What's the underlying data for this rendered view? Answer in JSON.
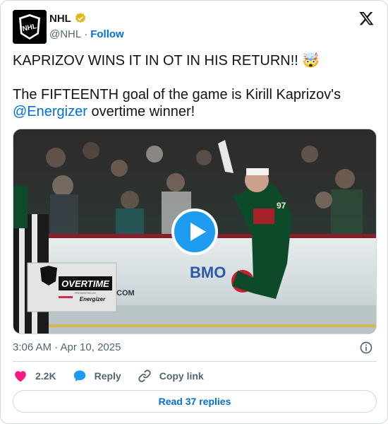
{
  "author": {
    "name": "NHL",
    "handle": "@NHL",
    "separator": "·",
    "follow_label": "Follow",
    "avatar_text": "NHL",
    "verified_color": "#e2b719"
  },
  "tweet": {
    "line1": "KAPRIZOV WINS IT IN OT IN HIS RETURN!! 🤯",
    "line2_a": "The FIFTEENTH goal of the game is Kirill Kaprizov's ",
    "mention": "@Energizer",
    "line2_b": " overtime winner!"
  },
  "media": {
    "type": "video",
    "overlay_title": "OVERTIME",
    "overlay_sub": "PRESENTED BY",
    "overlay_brand": "Energizer",
    "jersey_number": "97",
    "arena_text": "BMO",
    "sign_text": "COM"
  },
  "meta": {
    "timestamp": "3:06 AM · Apr 10, 2025"
  },
  "actions": {
    "likes": "2.2K",
    "reply_label": "Reply",
    "copy_label": "Copy link"
  },
  "read_replies_label": "Read 37 replies",
  "colors": {
    "link": "#006fd6",
    "like": "#f91880",
    "reply": "#1d9bf0",
    "muted": "#536471",
    "border": "#cfd9de"
  }
}
